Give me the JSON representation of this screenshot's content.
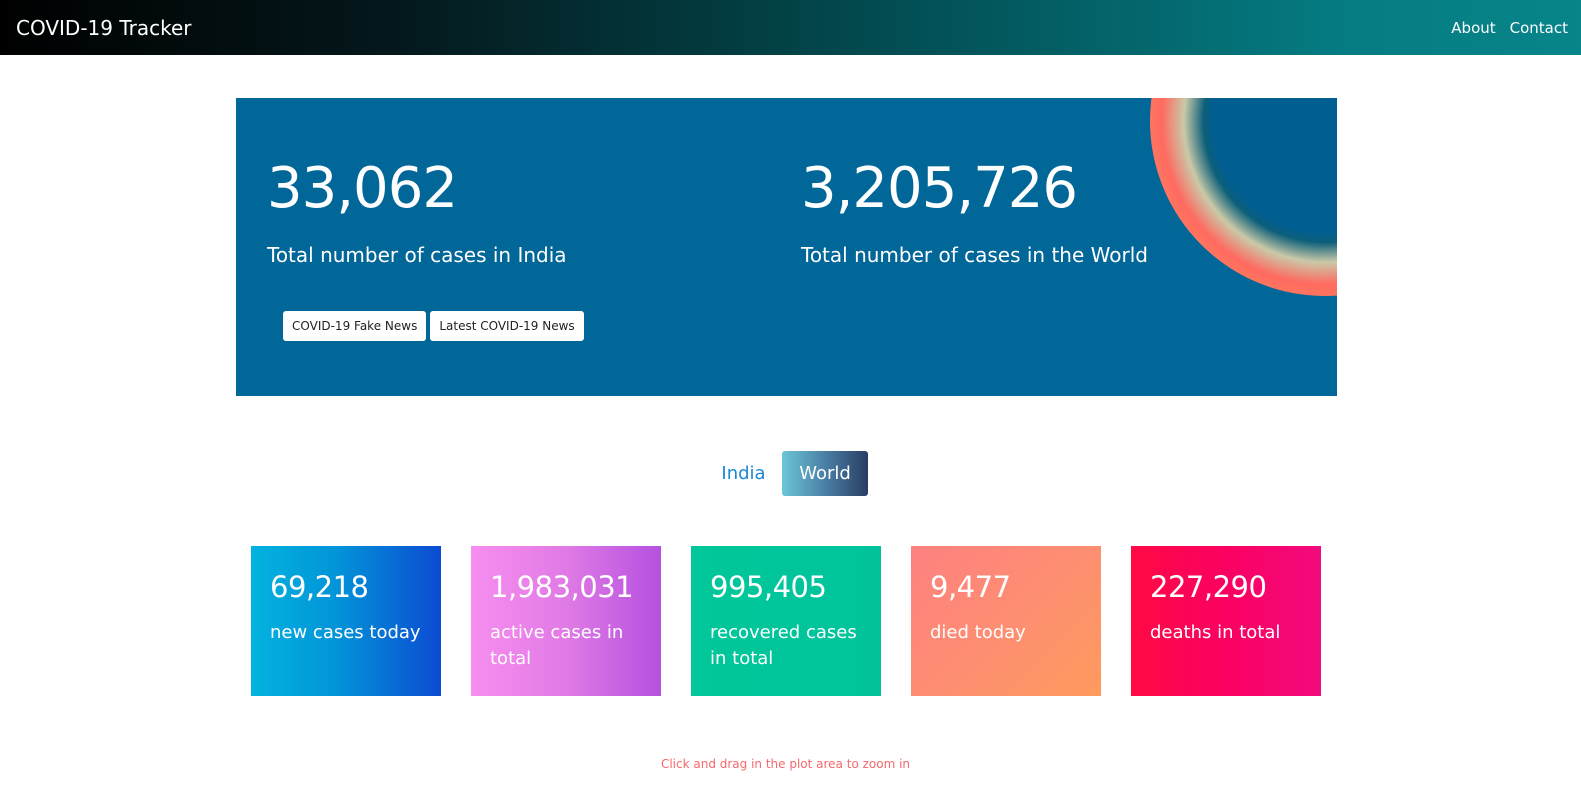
{
  "navbar": {
    "brand": "COVID-19 Tracker",
    "links": [
      "About",
      "Contact"
    ]
  },
  "hero": {
    "india_total": "33,062",
    "india_label": "Total number of cases in India",
    "world_total": "3,205,726",
    "world_label": "Total number of cases in the World",
    "buttons": [
      "COVID-19 Fake News",
      "Latest COVID-19 News"
    ]
  },
  "toggle": {
    "options": [
      "India",
      "World"
    ],
    "selected": "World"
  },
  "stats": [
    {
      "value": "69,218",
      "label": "new cases today"
    },
    {
      "value": "1,983,031",
      "label": "active cases in total"
    },
    {
      "value": "995,405",
      "label": "recovered cases in total"
    },
    {
      "value": "9,477",
      "label": "died today"
    },
    {
      "value": "227,290",
      "label": "deaths in total"
    }
  ],
  "chart_hint": "Click and drag in the plot area to zoom in",
  "colors": {
    "hero_background": "#016698",
    "toggle_active_text": "#ffffff",
    "toggle_inactive_text": "#1a88d8",
    "hint_text": "#f5686c"
  }
}
